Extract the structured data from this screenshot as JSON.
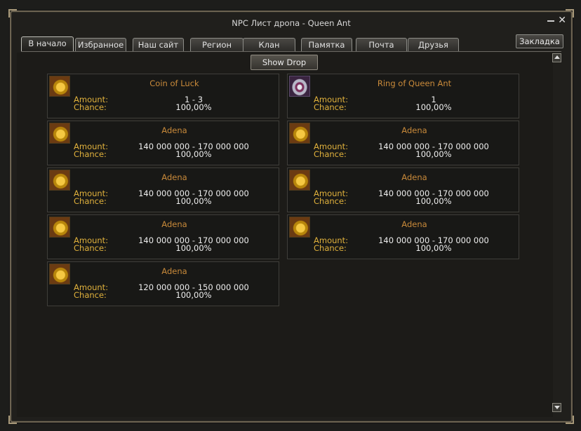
{
  "window": {
    "title": "NPC Лист дропа - Queen Ant"
  },
  "tabs": [
    {
      "label": "В начало",
      "active": true
    },
    {
      "label": "Избранное",
      "active": false
    },
    {
      "label": "Наш сайт",
      "active": false
    },
    {
      "label": "Регион",
      "active": false
    },
    {
      "label": "Клан",
      "active": false
    },
    {
      "label": "Памятка",
      "active": false
    },
    {
      "label": "Почта",
      "active": false
    },
    {
      "label": "Друзья",
      "active": false
    }
  ],
  "bookmark_label": "Закладка",
  "show_drop_label": "Show Drop",
  "labels": {
    "amount": "Amount:",
    "chance": "Chance:"
  },
  "drops": [
    {
      "name": "Coin of Luck",
      "amount": "1 - 3",
      "chance": "100,00%",
      "icon": "coin-icon"
    },
    {
      "name": "Ring of Queen Ant",
      "amount": "1",
      "chance": "100,00%",
      "icon": "ring-icon"
    },
    {
      "name": "Adena",
      "amount": "140 000 000 - 170 000 000",
      "chance": "100,00%",
      "icon": "adena-icon"
    },
    {
      "name": "Adena",
      "amount": "140 000 000 - 170 000 000",
      "chance": "100,00%",
      "icon": "adena-icon"
    },
    {
      "name": "Adena",
      "amount": "140 000 000 - 170 000 000",
      "chance": "100,00%",
      "icon": "adena-icon"
    },
    {
      "name": "Adena",
      "amount": "140 000 000 - 170 000 000",
      "chance": "100,00%",
      "icon": "adena-icon"
    },
    {
      "name": "Adena",
      "amount": "140 000 000 - 170 000 000",
      "chance": "100,00%",
      "icon": "adena-icon"
    },
    {
      "name": "Adena",
      "amount": "140 000 000 - 170 000 000",
      "chance": "100,00%",
      "icon": "adena-icon"
    },
    {
      "name": "Adena",
      "amount": "120 000 000 - 150 000 000",
      "chance": "100,00%",
      "icon": "adena-icon"
    }
  ]
}
